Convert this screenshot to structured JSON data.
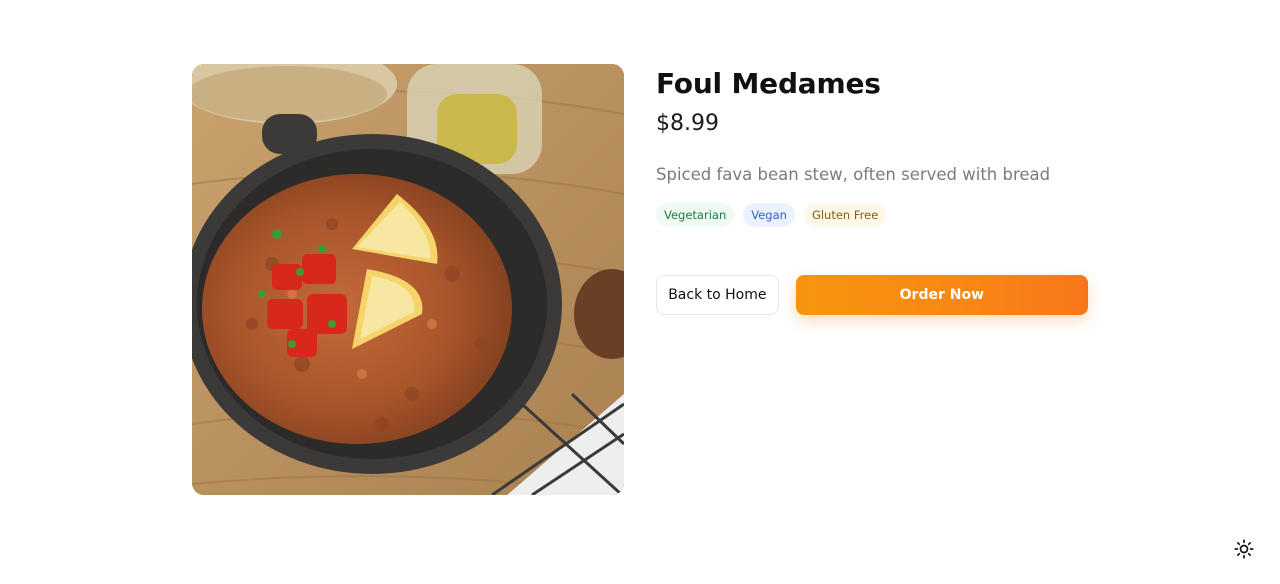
{
  "dish": {
    "name": "Foul Medames",
    "price": "$8.99",
    "description": "Spiced fava bean stew, often served with bread",
    "image_alt": "Foul Medames",
    "tags": [
      "Vegetarian",
      "Vegan",
      "Gluten Free"
    ]
  },
  "actions": {
    "back_label": "Back to Home",
    "order_label": "Order Now"
  },
  "icons": {
    "theme_toggle": "sun-icon"
  },
  "colors": {
    "accent_start": "#f7950f",
    "accent_end": "#f8761b",
    "tag_vegetarian_text": "#1f7a44",
    "tag_vegan_text": "#2c5fc9",
    "tag_gluten_free_text": "#8a5b12"
  }
}
